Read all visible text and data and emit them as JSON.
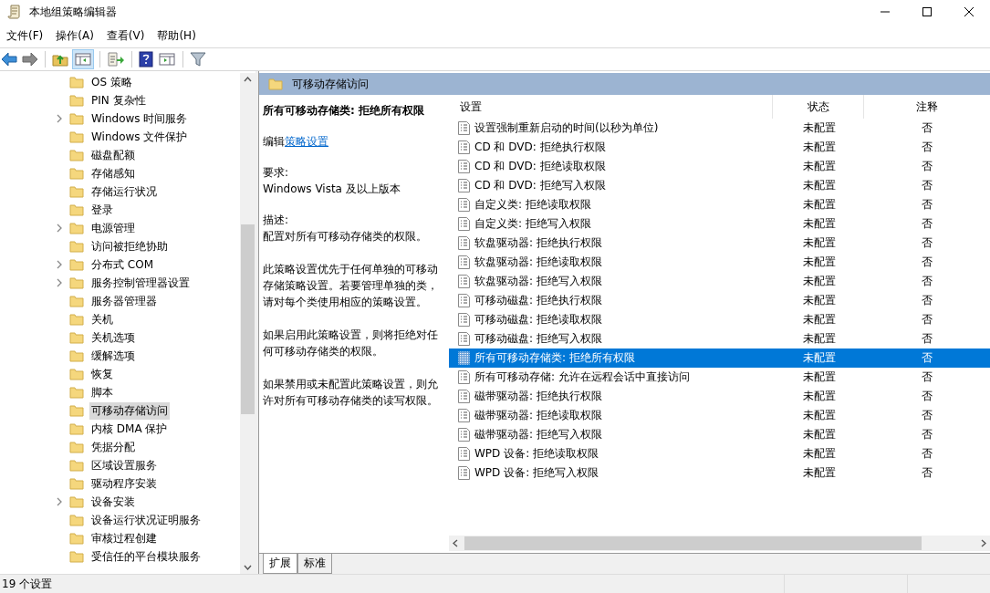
{
  "window": {
    "title": "本地组策略编辑器"
  },
  "menu": [
    "文件(F)",
    "操作(A)",
    "查看(V)",
    "帮助(H)"
  ],
  "tree": {
    "items": [
      {
        "label": "OS 策略",
        "expandable": false,
        "selected": false
      },
      {
        "label": "PIN 复杂性",
        "expandable": false,
        "selected": false
      },
      {
        "label": "Windows 时间服务",
        "expandable": true,
        "selected": false
      },
      {
        "label": "Windows 文件保护",
        "expandable": false,
        "selected": false
      },
      {
        "label": "磁盘配额",
        "expandable": false,
        "selected": false
      },
      {
        "label": "存储感知",
        "expandable": false,
        "selected": false
      },
      {
        "label": "存储运行状况",
        "expandable": false,
        "selected": false
      },
      {
        "label": "登录",
        "expandable": false,
        "selected": false
      },
      {
        "label": "电源管理",
        "expandable": true,
        "selected": false
      },
      {
        "label": "访问被拒绝协助",
        "expandable": false,
        "selected": false
      },
      {
        "label": "分布式 COM",
        "expandable": true,
        "selected": false
      },
      {
        "label": "服务控制管理器设置",
        "expandable": true,
        "selected": false
      },
      {
        "label": "服务器管理器",
        "expandable": false,
        "selected": false
      },
      {
        "label": "关机",
        "expandable": false,
        "selected": false
      },
      {
        "label": "关机选项",
        "expandable": false,
        "selected": false
      },
      {
        "label": "缓解选项",
        "expandable": false,
        "selected": false
      },
      {
        "label": "恢复",
        "expandable": false,
        "selected": false
      },
      {
        "label": "脚本",
        "expandable": false,
        "selected": false
      },
      {
        "label": "可移动存储访问",
        "expandable": false,
        "selected": true
      },
      {
        "label": "内核 DMA 保护",
        "expandable": false,
        "selected": false
      },
      {
        "label": "凭据分配",
        "expandable": false,
        "selected": false
      },
      {
        "label": "区域设置服务",
        "expandable": false,
        "selected": false
      },
      {
        "label": "驱动程序安装",
        "expandable": false,
        "selected": false
      },
      {
        "label": "设备安装",
        "expandable": true,
        "selected": false
      },
      {
        "label": "设备运行状况证明服务",
        "expandable": false,
        "selected": false
      },
      {
        "label": "审核过程创建",
        "expandable": false,
        "selected": false
      },
      {
        "label": "受信任的平台模块服务",
        "expandable": false,
        "selected": false
      }
    ]
  },
  "panel_header": "可移动存储访问",
  "details": {
    "title": "所有可移动存储类: 拒绝所有权限",
    "edit_prefix": "编辑",
    "edit_link": "策略设置",
    "requirements_label": "要求:",
    "requirements": "Windows Vista 及以上版本",
    "description_label": "描述:",
    "paragraphs": [
      "配置对所有可移动存储类的权限。",
      "此策略设置优先于任何单独的可移动存储策略设置。若要管理单独的类，请对每个类使用相应的策略设置。",
      "如果启用此策略设置，则将拒绝对任何可移动存储类的权限。",
      "如果禁用或未配置此策略设置，则允许对所有可移动存储类的读写权限。"
    ]
  },
  "table": {
    "columns": [
      "设置",
      "状态",
      "注释"
    ],
    "rows": [
      {
        "setting": "设置强制重新启动的时间(以秒为单位)",
        "state": "未配置",
        "comment": "否",
        "selected": false
      },
      {
        "setting": "CD 和 DVD: 拒绝执行权限",
        "state": "未配置",
        "comment": "否",
        "selected": false
      },
      {
        "setting": "CD 和 DVD: 拒绝读取权限",
        "state": "未配置",
        "comment": "否",
        "selected": false
      },
      {
        "setting": "CD 和 DVD: 拒绝写入权限",
        "state": "未配置",
        "comment": "否",
        "selected": false
      },
      {
        "setting": "自定义类: 拒绝读取权限",
        "state": "未配置",
        "comment": "否",
        "selected": false
      },
      {
        "setting": "自定义类: 拒绝写入权限",
        "state": "未配置",
        "comment": "否",
        "selected": false
      },
      {
        "setting": "软盘驱动器: 拒绝执行权限",
        "state": "未配置",
        "comment": "否",
        "selected": false
      },
      {
        "setting": "软盘驱动器: 拒绝读取权限",
        "state": "未配置",
        "comment": "否",
        "selected": false
      },
      {
        "setting": "软盘驱动器: 拒绝写入权限",
        "state": "未配置",
        "comment": "否",
        "selected": false
      },
      {
        "setting": "可移动磁盘: 拒绝执行权限",
        "state": "未配置",
        "comment": "否",
        "selected": false
      },
      {
        "setting": "可移动磁盘: 拒绝读取权限",
        "state": "未配置",
        "comment": "否",
        "selected": false
      },
      {
        "setting": "可移动磁盘: 拒绝写入权限",
        "state": "未配置",
        "comment": "否",
        "selected": false
      },
      {
        "setting": "所有可移动存储类: 拒绝所有权限",
        "state": "未配置",
        "comment": "否",
        "selected": true
      },
      {
        "setting": "所有可移动存储: 允许在远程会话中直接访问",
        "state": "未配置",
        "comment": "否",
        "selected": false
      },
      {
        "setting": "磁带驱动器: 拒绝执行权限",
        "state": "未配置",
        "comment": "否",
        "selected": false
      },
      {
        "setting": "磁带驱动器: 拒绝读取权限",
        "state": "未配置",
        "comment": "否",
        "selected": false
      },
      {
        "setting": "磁带驱动器: 拒绝写入权限",
        "state": "未配置",
        "comment": "否",
        "selected": false
      },
      {
        "setting": "WPD 设备: 拒绝读取权限",
        "state": "未配置",
        "comment": "否",
        "selected": false
      },
      {
        "setting": "WPD 设备: 拒绝写入权限",
        "state": "未配置",
        "comment": "否",
        "selected": false
      }
    ]
  },
  "tabs": [
    {
      "label": "扩展",
      "selected": true
    },
    {
      "label": "标准",
      "selected": false
    }
  ],
  "status_bar": "19 个设置"
}
